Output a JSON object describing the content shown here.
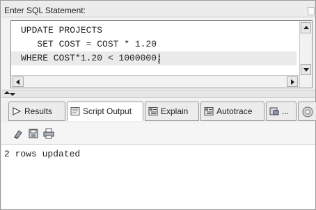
{
  "header": {
    "label": "Enter SQL Statement:"
  },
  "editor": {
    "lines": [
      "UPDATE PROJECTS",
      "   SET COST = COST * 1.20",
      "WHERE COST*1.20 < 1000000;"
    ]
  },
  "tabs": [
    {
      "label": "Results",
      "icon": "play-icon"
    },
    {
      "label": "Script Output",
      "icon": "script-output-icon"
    },
    {
      "label": "Explain",
      "icon": "explain-icon"
    },
    {
      "label": "Autotrace",
      "icon": "autotrace-icon"
    },
    {
      "label": "...",
      "icon": "dbms-output-icon"
    }
  ],
  "toolbar": {
    "icons": [
      "eraser-icon",
      "save-icon",
      "print-icon"
    ]
  },
  "output": {
    "text": "2 rows updated"
  }
}
